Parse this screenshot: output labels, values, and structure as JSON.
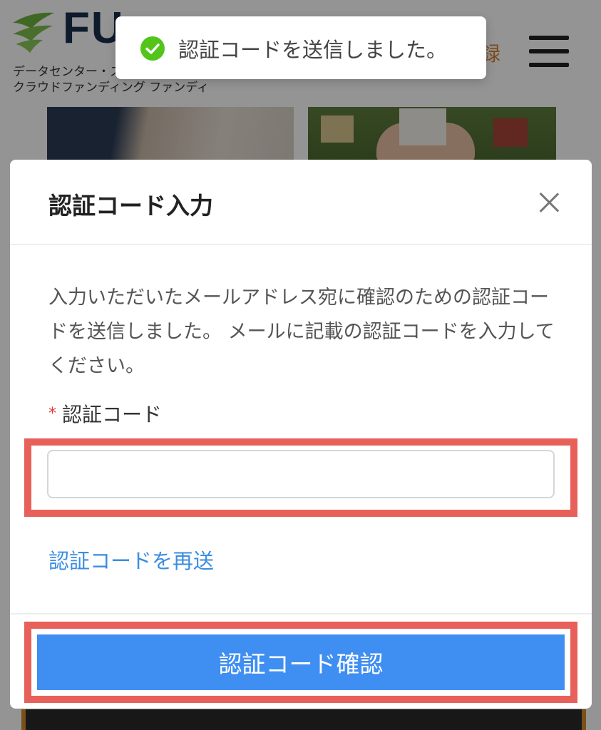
{
  "background": {
    "logo_text": "FU",
    "logo_subtitle_line1": "データセンター・ス",
    "logo_subtitle_line2": "クラウドファンディング ファンディ",
    "header_register_fragment": "録"
  },
  "toast": {
    "icon": "check-circle-icon",
    "message": "認証コードを送信しました。"
  },
  "modal": {
    "title": "認証コード入力",
    "description": "入力いただいたメールアドレス宛に確認のための認証コードを送信しました。 メールに記載の認証コードを入力してください。",
    "field_required_mark": "*",
    "field_label": "認証コード",
    "input_value": "",
    "resend_label": "認証コードを再送",
    "confirm_label": "認証コード確認"
  },
  "colors": {
    "primary_button": "#3f8ef2",
    "link": "#3b8de0",
    "highlight_box": "#e8605a",
    "toast_success": "#52c41a",
    "required_mark": "#e53935",
    "accent_orange": "#d9822b"
  }
}
